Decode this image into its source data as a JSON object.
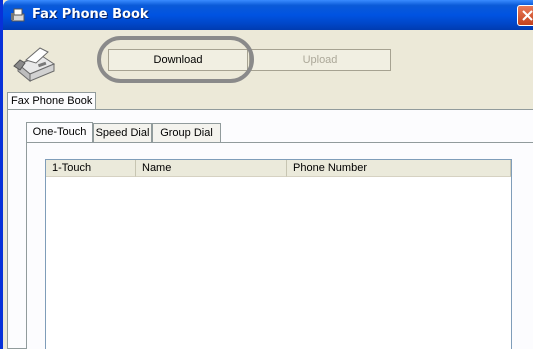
{
  "window": {
    "title": "Fax Phone Book"
  },
  "toolbar": {
    "download_label": "Download",
    "upload_label": "Upload"
  },
  "outer_tab": {
    "label": "Fax Phone Book"
  },
  "inner_tabs": [
    {
      "label": "One-Touch",
      "active": true
    },
    {
      "label": "Speed Dial",
      "active": false
    },
    {
      "label": "Group Dial",
      "active": false
    }
  ],
  "table": {
    "columns": [
      "1-Touch",
      "Name",
      "Phone Number"
    ],
    "rows": []
  },
  "icons": {
    "title": "fax-machine-icon",
    "close": "close-icon",
    "fax": "fax-machine-icon"
  },
  "colors": {
    "titlebar": "#0053e1",
    "close": "#c3411c",
    "highlight_ring": "#8a8a8a"
  }
}
